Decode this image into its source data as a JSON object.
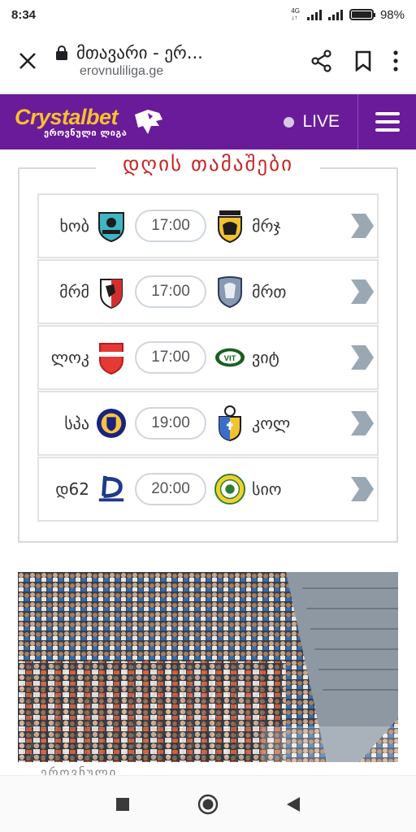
{
  "status_bar": {
    "time": "8:34",
    "network": "4G",
    "battery": "98%"
  },
  "browser": {
    "page_title": "მთავარი - ერ...",
    "domain": "erovnuliliga.ge"
  },
  "site_header": {
    "brand": "Crystalbet",
    "brand_sub": "ეროვნული ლიგა",
    "live_label": "LIVE",
    "brand_color": "#6a1b9a",
    "accent_color": "#f7c12b"
  },
  "matches": {
    "title": "დღის თამაშები",
    "items": [
      {
        "home": "ხობ",
        "time": "17:00",
        "away": "მრჯ"
      },
      {
        "home": "მრმ",
        "time": "17:00",
        "away": "მრთ"
      },
      {
        "home": "ლოკ",
        "time": "17:00",
        "away": "ვიტ"
      },
      {
        "home": "სპა",
        "time": "19:00",
        "away": "კოლ"
      },
      {
        "home": "დ62",
        "time": "20:00",
        "away": "სიო"
      }
    ]
  },
  "news": {
    "caption": "ეროვნული"
  },
  "icons": [
    "close-icon",
    "lock-icon",
    "share-icon",
    "bookmark-icon",
    "more-icon",
    "menu-icon",
    "chevron-right-icon",
    "recents-icon",
    "home-icon",
    "back-icon"
  ]
}
